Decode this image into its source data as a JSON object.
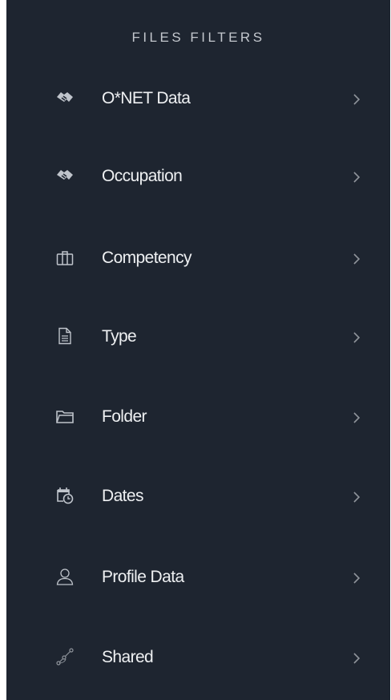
{
  "panel": {
    "title": "FILES FILTERS",
    "background": "#1e2530",
    "items": [
      {
        "label": "O*NET Data",
        "icon": "handshake-icon"
      },
      {
        "label": "Occupation",
        "icon": "handshake-icon"
      },
      {
        "label": "Competency",
        "icon": "briefcase-icon"
      },
      {
        "label": "Type",
        "icon": "document-icon"
      },
      {
        "label": "Folder",
        "icon": "folder-icon"
      },
      {
        "label": "Dates",
        "icon": "calendar-clock-icon"
      },
      {
        "label": "Profile Data",
        "icon": "user-icon"
      },
      {
        "label": "Shared",
        "icon": "share-nodes-icon"
      }
    ]
  }
}
